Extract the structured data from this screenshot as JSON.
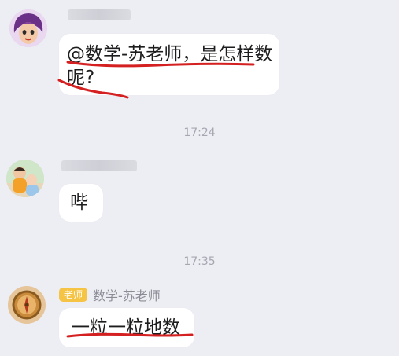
{
  "messages": [
    {
      "sender": "",
      "text_line1": "@数学-苏老师，是怎样数",
      "text_line2": "呢?"
    },
    {
      "sender": "",
      "text": "哔"
    },
    {
      "sender_badge": "老师",
      "sender": "数学-苏老师",
      "text": "一粒一粒地数"
    }
  ],
  "timestamps": [
    "17:24",
    "17:35"
  ],
  "annotation_color": "#d42020"
}
